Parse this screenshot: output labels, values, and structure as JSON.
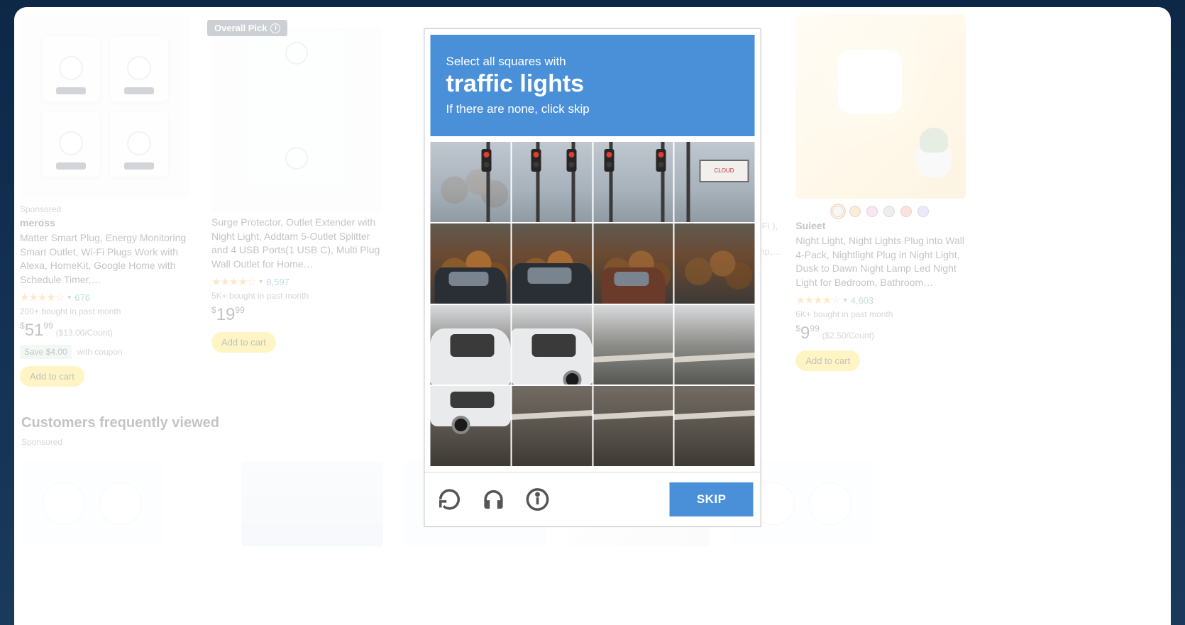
{
  "products": [
    {
      "sponsored": "Sponsored",
      "brand": "meross",
      "title": "Matter Smart Plug, Energy Monitoring Smart Outlet, Wi-Fi Plugs Work with Alexa, HomeKit, Google Home with Schedule Timer,…",
      "rating_count": "676",
      "bought": "200+ bought in past month",
      "price_whole": "51",
      "price_frac": "99",
      "price_note": "($13.00/Count)",
      "coupon": "Save $4.00",
      "coupon_note": "with coupon",
      "add": "Add to cart"
    },
    {
      "pick_label": "Overall Pick",
      "title": "Surge Protector, Outlet Extender with Night Light, Addtam 5-Outlet Splitter and 4 USB Ports(1 USB C), Multi Plug Wall Outlet for Home…",
      "rating_count": "8,597",
      "bought": "5K+ bought in past month",
      "price_whole": "19",
      "price_frac": "99",
      "add": "Add to cart"
    },
    {
      "side_text": "Vi-Fi\n),\nb\nAmp,…"
    },
    {
      "brand": "Suieet",
      "title": "Night Light, Night Lights Plug into Wall 4-Pack, Nightlight Plug in Night Light, Dusk to Dawn Night Lamp Led Night Light for Bedroom, Bathroom…",
      "rating_count": "4,603",
      "bought": "6K+ bought in past month",
      "price_whole": "9",
      "price_frac": "99",
      "price_note": "($2.50/Count)",
      "add": "Add to cart",
      "swatches": [
        "#e6d9cf",
        "#f2b35c",
        "#e99acb",
        "#b9bbbc",
        "#f28a5f",
        "#a9aef2"
      ]
    }
  ],
  "freq": {
    "title": "Customers frequently viewed",
    "sponsored": "Sponsored"
  },
  "captcha": {
    "line1": "Select all squares with",
    "target": "traffic lights",
    "line2": "If there are none, click skip",
    "skip": "SKIP",
    "billboard": "CLOUD"
  },
  "stars": "★★★★☆"
}
